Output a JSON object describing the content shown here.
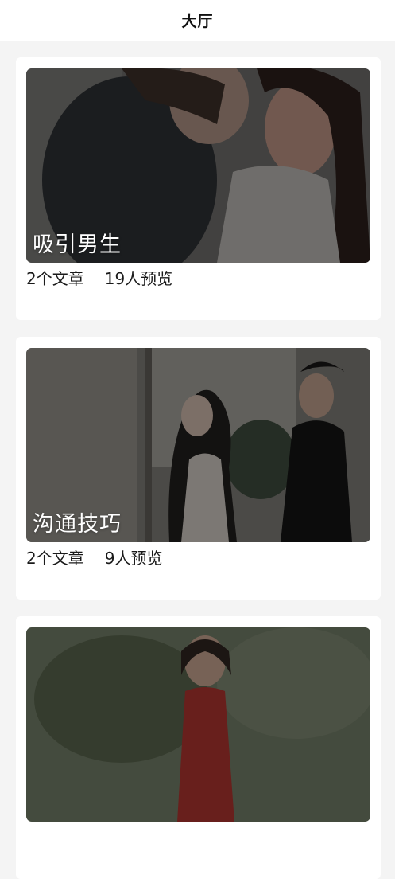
{
  "header": {
    "title": "大厅"
  },
  "cards": [
    {
      "title": "吸引男生",
      "articles": "2个文章",
      "views": "19人预览",
      "image_subject": "couple embracing photo"
    },
    {
      "title": "沟通技巧",
      "articles": "2个文章",
      "views": "9人预览",
      "image_subject": "couple standing by window photo"
    },
    {
      "title": "",
      "articles": "",
      "views": "",
      "image_subject": "woman with phone outdoors photo"
    }
  ],
  "colors": {
    "page_background": "#f4f4f4",
    "card_background": "#ffffff",
    "image_overlay": "#000000"
  }
}
